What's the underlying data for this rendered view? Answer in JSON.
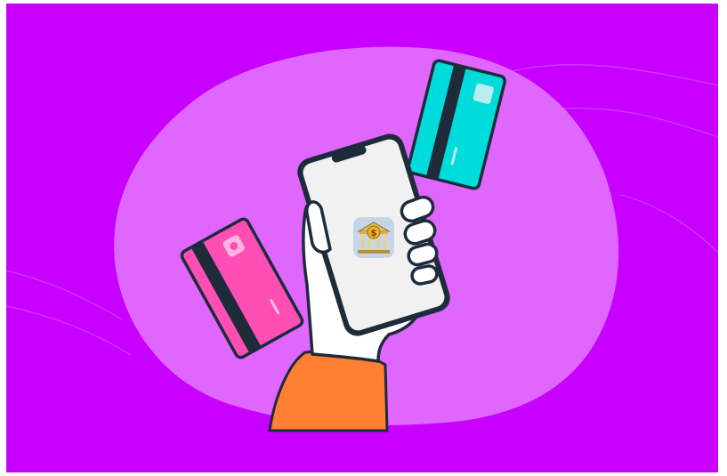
{
  "illustration": {
    "background_color": "#C800FF",
    "blob_color": "#DF66FF",
    "outline_color": "#1E2B3A",
    "sleeve_color": "#FF8033",
    "card_pink_color": "#FF4FB4",
    "card_teal_color": "#00DCDC",
    "phone_screen_color": "#F1F1F1",
    "app_icon_bg_color": "#C6D6E6",
    "bank_icon_color": "#E8C060",
    "icons": {
      "bank": "bank-icon",
      "dollar": "dollar-sign-icon"
    }
  }
}
